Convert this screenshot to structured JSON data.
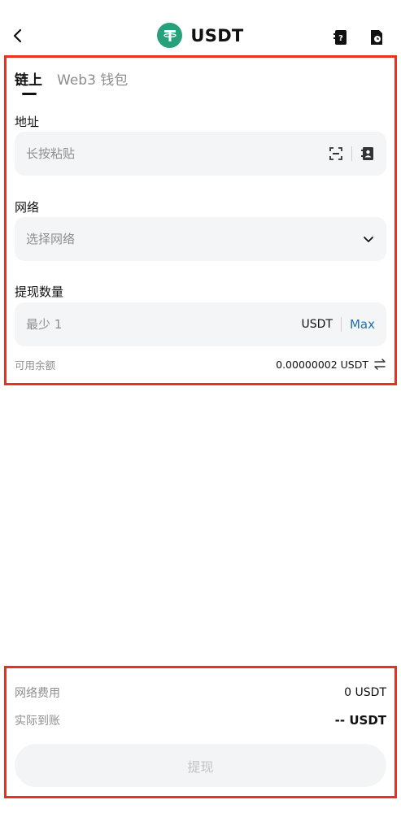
{
  "header": {
    "title": "USDT",
    "back_icon": "chevron-left-icon",
    "coin_logo": "tether-logo",
    "address_book_icon": "address-book-icon",
    "history_icon": "history-icon"
  },
  "tabs": [
    {
      "label": "链上",
      "active": true
    },
    {
      "label": "Web3 钱包",
      "active": false
    }
  ],
  "address": {
    "label": "地址",
    "placeholder": "长按粘贴",
    "scan_icon": "scan-icon",
    "contacts_icon": "contacts-icon"
  },
  "network": {
    "label": "网络",
    "placeholder": "选择网络",
    "dropdown_icon": "chevron-down-icon"
  },
  "amount": {
    "label": "提现数量",
    "placeholder": "最少 1",
    "unit": "USDT",
    "max_label": "Max"
  },
  "balance": {
    "label": "可用余额",
    "value": "0.00000002 USDT",
    "swap_icon": "swap-icon"
  },
  "summary": {
    "fee_label": "网络费用",
    "fee_value": "0 USDT",
    "received_label": "实际到账",
    "received_value": "-- USDT"
  },
  "submit": {
    "label": "提现"
  },
  "colors": {
    "accent_link": "#1f6fb2",
    "tether_green": "#26a17b",
    "highlight_border": "#e8321e"
  }
}
